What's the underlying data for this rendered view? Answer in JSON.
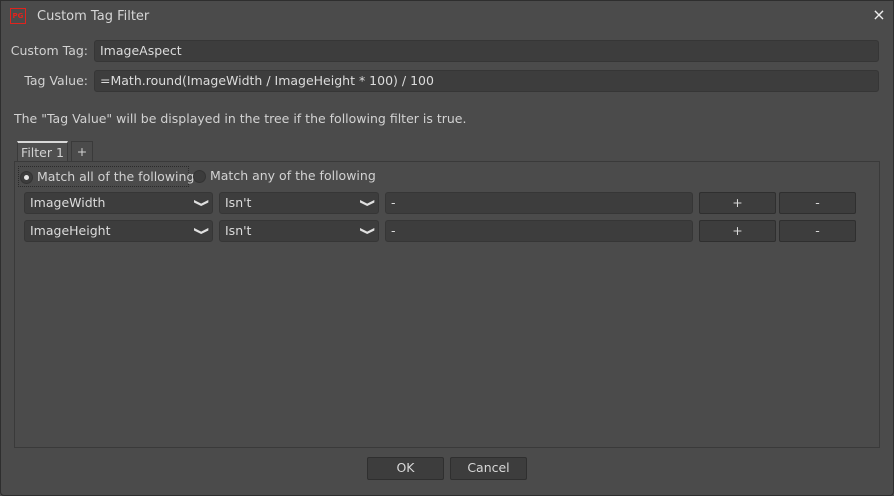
{
  "window": {
    "title": "Custom Tag Filter",
    "logo": "PG",
    "close_icon": "×"
  },
  "form": {
    "custom_tag_label": "Custom Tag:",
    "custom_tag_value": "ImageAspect",
    "tag_value_label": "Tag Value:",
    "tag_value_value": "=Math.round(ImageWidth / ImageHeight * 100) / 100",
    "info": "The \"Tag Value\" will be displayed in the tree if the following filter is true."
  },
  "tabs": [
    {
      "label": "Filter 1",
      "active": true
    },
    {
      "label": "+"
    }
  ],
  "match": {
    "all_label": "Match all of the following",
    "any_label": "Match any of the following",
    "selected": "all"
  },
  "rows": [
    {
      "field": "ImageWidth",
      "operator": "Isn't",
      "value": "-",
      "add": "+",
      "remove": "-"
    },
    {
      "field": "ImageHeight",
      "operator": "Isn't",
      "value": "-",
      "add": "+",
      "remove": "-"
    }
  ],
  "footer": {
    "ok": "OK",
    "cancel": "Cancel"
  },
  "colors": {
    "background": "#4b4b4b",
    "input": "#3d3d3d",
    "logo": "#e0231d"
  }
}
